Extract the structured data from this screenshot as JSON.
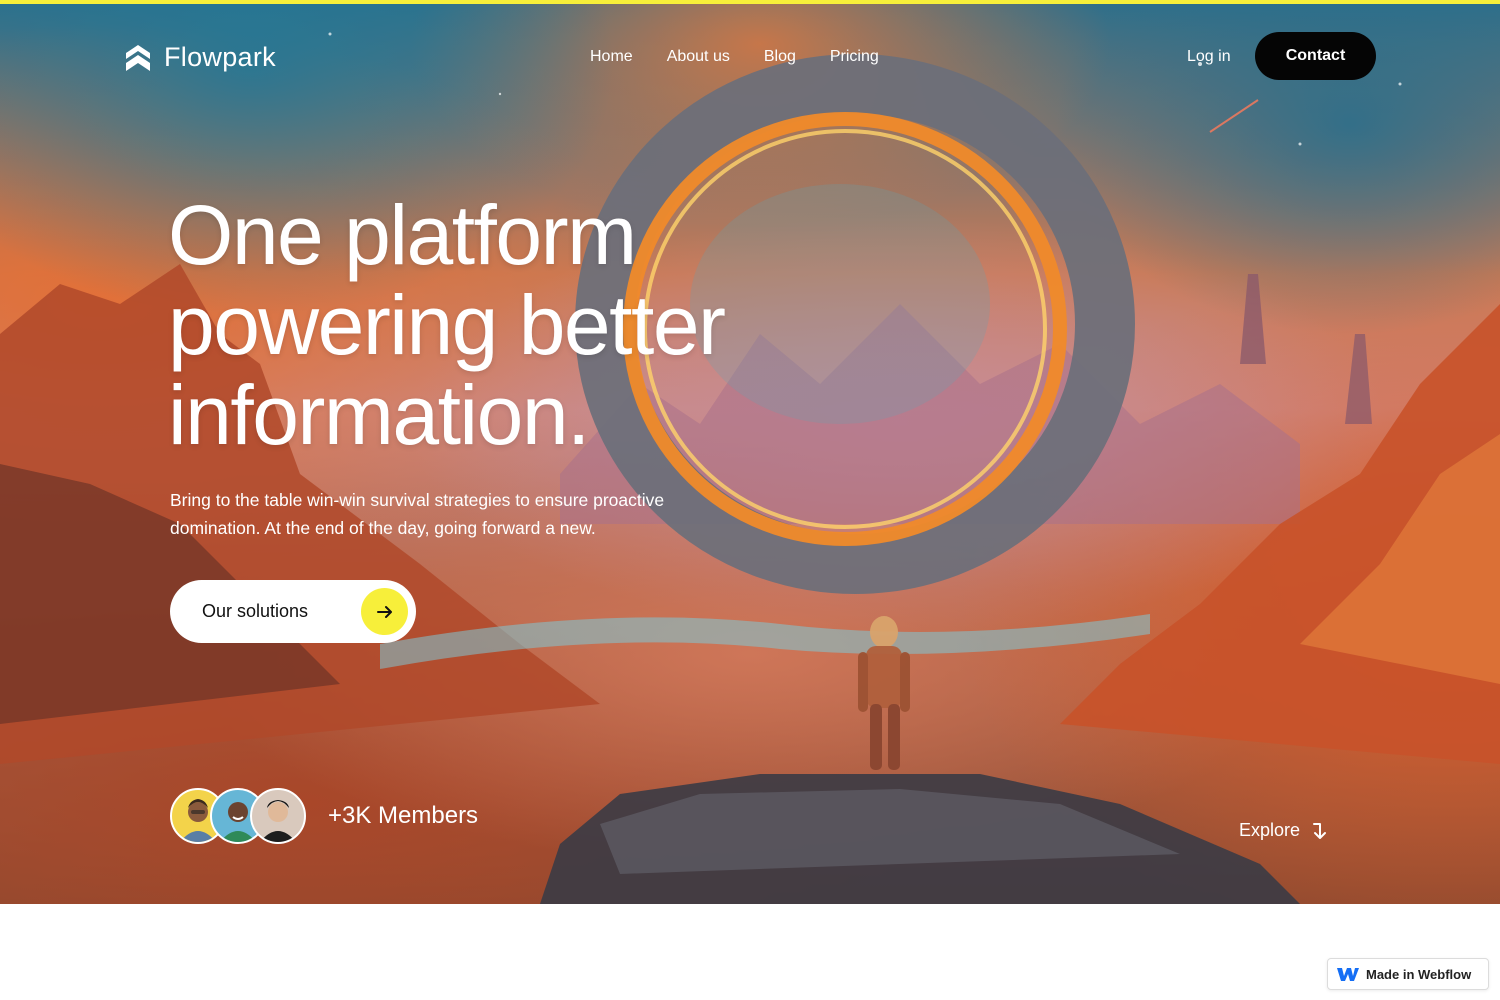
{
  "brand": {
    "name": "Flowpark",
    "logo_icon": "flowpark-logo-icon"
  },
  "nav": {
    "links": [
      {
        "label": "Home"
      },
      {
        "label": "About us"
      },
      {
        "label": "Blog"
      },
      {
        "label": "Pricing"
      }
    ],
    "login_label": "Log in",
    "contact_label": "Contact"
  },
  "hero": {
    "headline_lines": [
      "One platform",
      "powering better",
      "information."
    ],
    "subtext": "Bring to the table win-win survival strategies to ensure proactive domination. At the end of the day, going forward a new.",
    "cta_label": "Our solutions",
    "cta_icon": "arrow-right-icon",
    "members_label": "+3K Members",
    "explore_label": "Explore",
    "explore_icon": "arrow-down-icon"
  },
  "badge": {
    "label": "Made in Webflow",
    "icon": "webflow-logo-icon"
  },
  "colors": {
    "accent_yellow": "#f7ef3a",
    "contact_bg": "#050505",
    "text_white": "#ffffff"
  }
}
